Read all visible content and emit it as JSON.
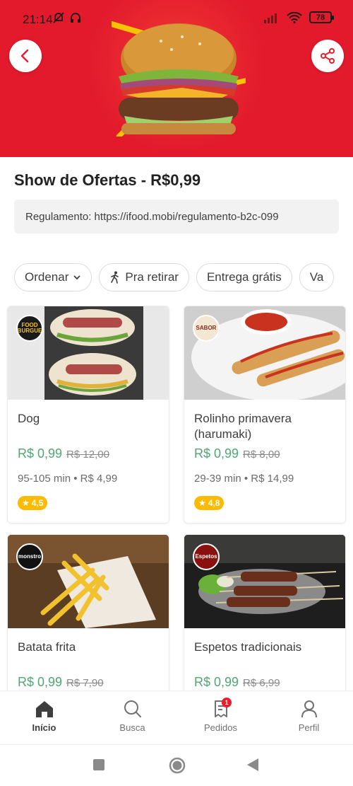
{
  "status_bar": {
    "time": "21:14",
    "battery": "78"
  },
  "header": {
    "title": "Show de Ofertas - R$0,99",
    "regulation": "Regulamento: https://ifood.mobi/regulamento-b2c-099"
  },
  "filters": [
    {
      "label": "Ordenar"
    },
    {
      "label": "Pra retirar"
    },
    {
      "label": "Entrega grátis"
    },
    {
      "label": "Va"
    }
  ],
  "items": [
    {
      "name": "Dog",
      "price": "R$ 0,99",
      "old_price": "R$ 12,00",
      "meta": "95-105 min • R$ 4,99",
      "rating": "4,5",
      "logo_text": "FOOD BURGUE"
    },
    {
      "name": "Rolinho primavera (harumaki)",
      "price": "R$ 0,99",
      "old_price": "R$ 8,00",
      "meta": "29-39 min • R$ 14,99",
      "rating": "4,8",
      "logo_text": "SABOR"
    },
    {
      "name": "Batata frita",
      "price": "R$ 0,99",
      "old_price": "R$ 7,90",
      "logo_text": "monstro"
    },
    {
      "name": "Espetos tradicionais",
      "price": "R$ 0,99",
      "old_price": "R$ 6,99",
      "logo_text": "Espetos"
    }
  ],
  "nav": [
    {
      "label": "Início",
      "icon": "home-icon"
    },
    {
      "label": "Busca",
      "icon": "search-icon"
    },
    {
      "label": "Pedidos",
      "icon": "orders-icon",
      "badge": "1"
    },
    {
      "label": "Perfil",
      "icon": "profile-icon"
    }
  ],
  "colors": {
    "brand": "#ea1d2c",
    "price": "#50a773",
    "rating": "#fcbb00"
  }
}
